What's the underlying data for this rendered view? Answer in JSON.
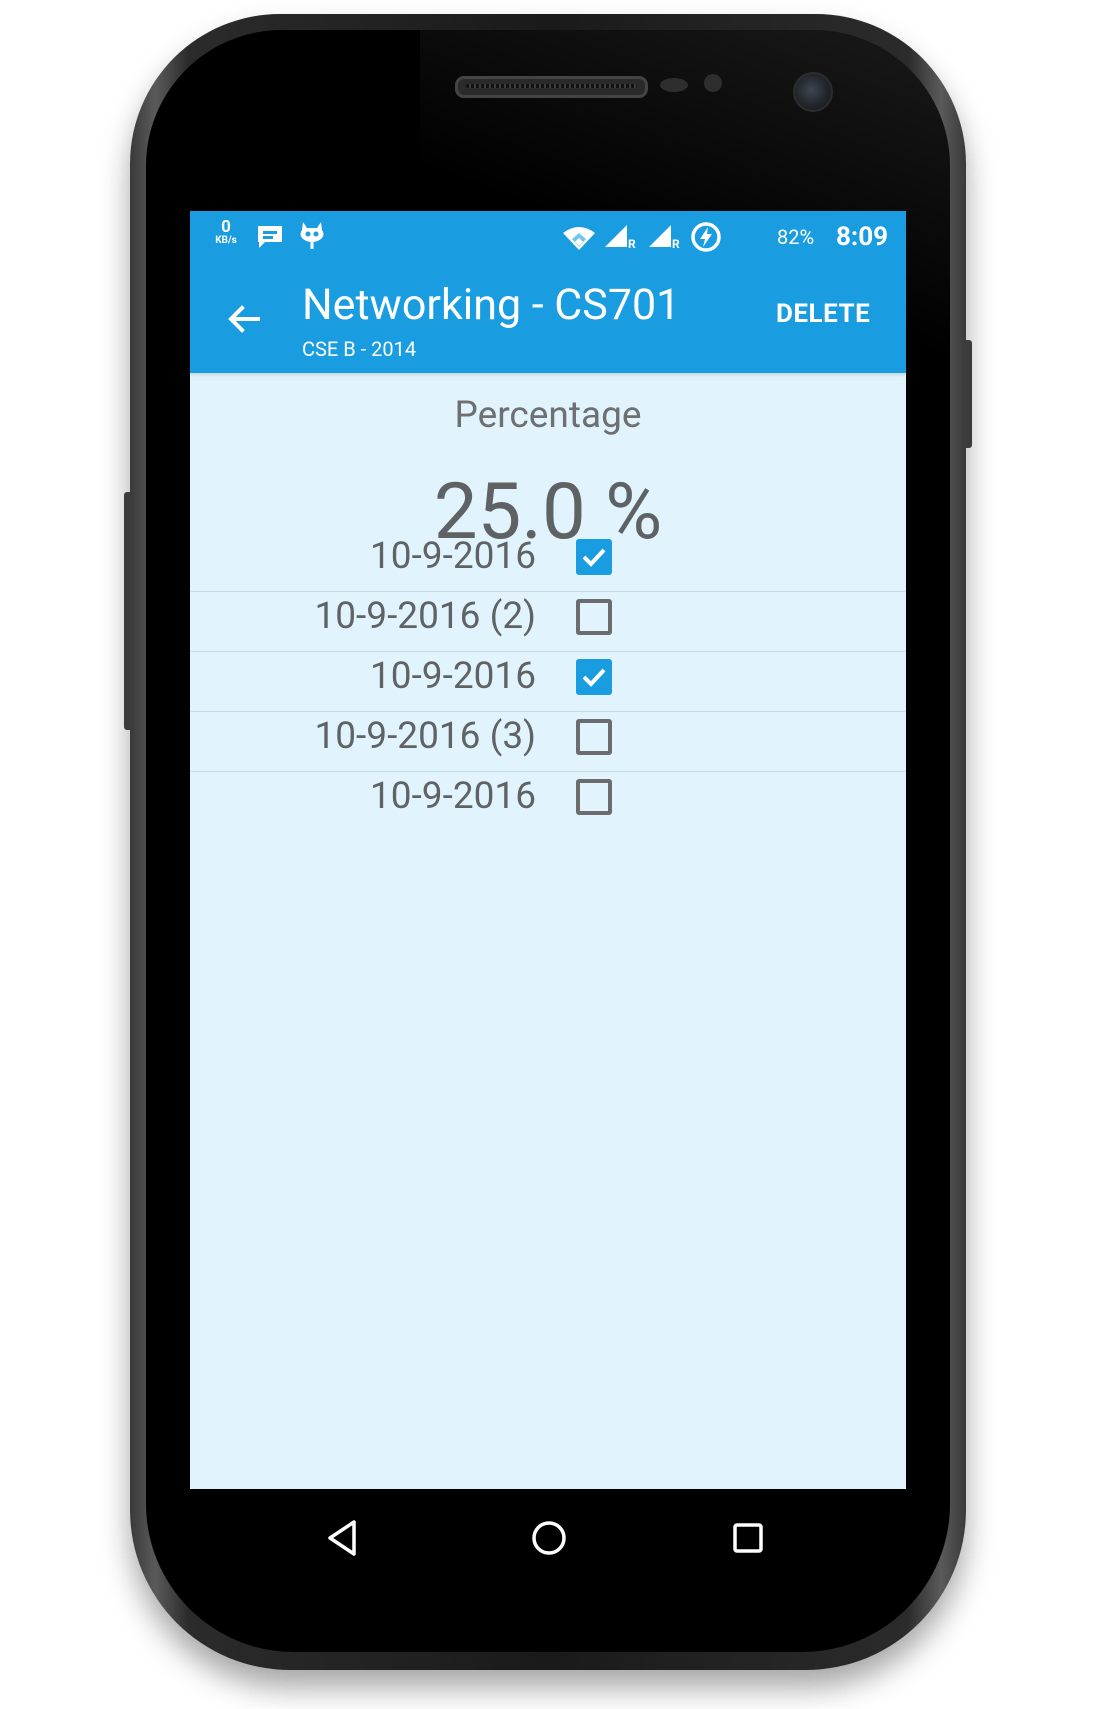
{
  "status_bar": {
    "speed_value": "0",
    "speed_unit": "KB/s",
    "icons": [
      "message-icon",
      "cyanogen-icon",
      "wifi-icon",
      "signal-r-icon",
      "signal-r-icon",
      "battery-saver-icon"
    ],
    "signal_roaming_1": "R",
    "signal_roaming_2": "R",
    "battery_percent": "82%",
    "time": "8:09"
  },
  "app_bar": {
    "title": "Networking - CS701",
    "subtitle": "CSE B - 2014",
    "action_delete": "DELETE"
  },
  "summary": {
    "label": "Percentage",
    "value": "25.0 %"
  },
  "attendance": [
    {
      "date": "10-9-2016",
      "checked": true
    },
    {
      "date": "10-9-2016 (2)",
      "checked": false
    },
    {
      "date": "10-9-2016",
      "checked": true
    },
    {
      "date": "10-9-2016 (3)",
      "checked": false
    },
    {
      "date": "10-9-2016",
      "checked": false
    }
  ],
  "nav_bar": {
    "icons": [
      "back-triangle-icon",
      "home-circle-icon",
      "recents-square-icon"
    ]
  },
  "colors": {
    "primary": "#1a9de0",
    "screen_background": "#e1f4fd",
    "text_gray": "#606366",
    "checkbox_off": "#6a6c6e"
  }
}
